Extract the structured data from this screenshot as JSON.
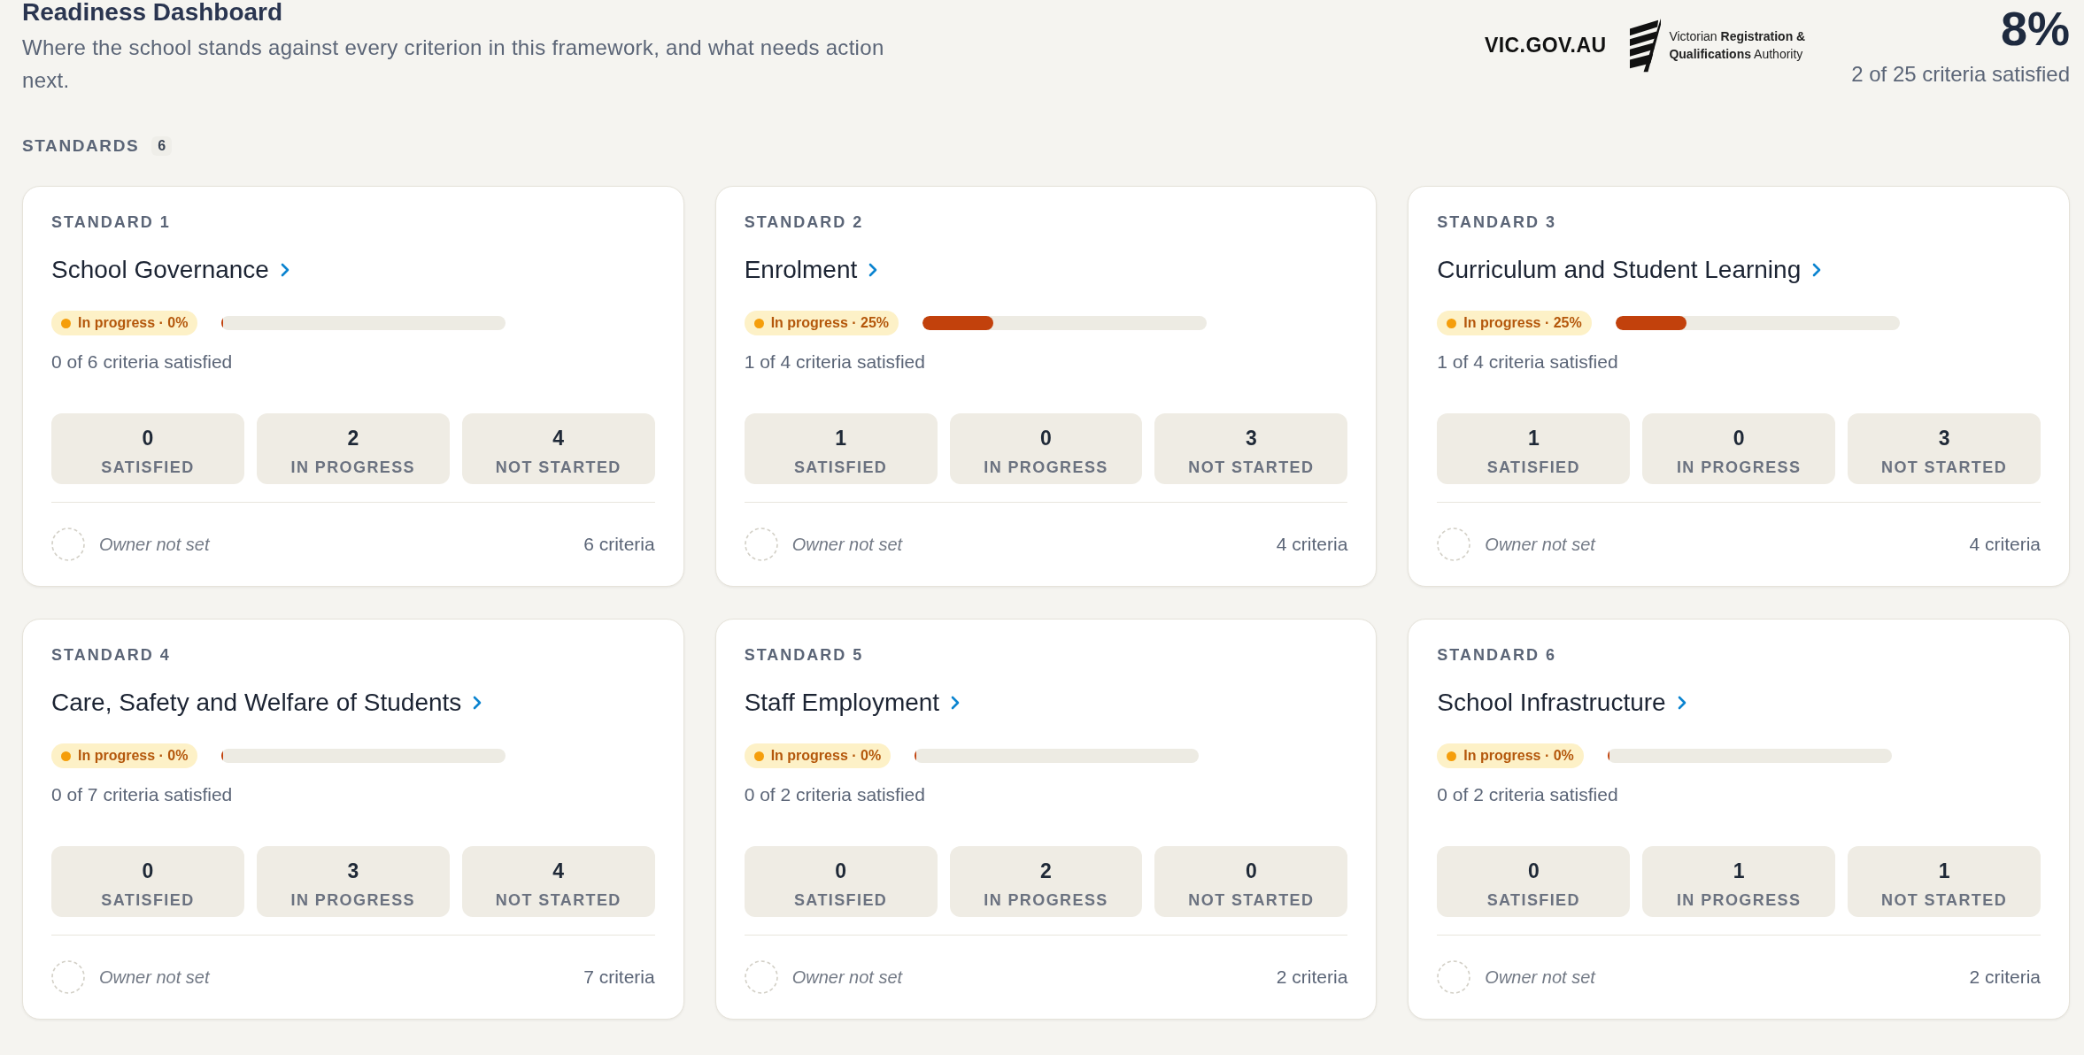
{
  "header": {
    "title": "Readiness Dashboard",
    "subtitle": "Where the school stands against every criterion in this framework, and what needs action next."
  },
  "logos": {
    "gov_wordmark": "VIC.GOV.AU",
    "authority_name": [
      "Victorian **Registration &**",
      "**Qualifications** Authority"
    ]
  },
  "summary": {
    "percent": "8%",
    "caption": "2 of 25 criteria satisfied"
  },
  "section": {
    "label": "STANDARDS",
    "count": "6"
  },
  "standards": [
    {
      "eyebrow": "STANDARD 1",
      "title": "School Governance",
      "status": {
        "kind": "in_progress",
        "label": "In progress · 0%"
      },
      "level": 0,
      "satisfied_text": "0 of 6 criteria satisfied",
      "stats": [
        {
          "value": "0",
          "label": "SATISFIED"
        },
        {
          "value": "2",
          "label": "IN PROGRESS"
        },
        {
          "value": "4",
          "label": "NOT STARTED"
        }
      ],
      "owner": "Owner not set",
      "criteria_count": "6 criteria"
    },
    {
      "eyebrow": "STANDARD 2",
      "title": "Enrolment",
      "status": {
        "kind": "in_progress",
        "label": "In progress · 25%"
      },
      "level": 0.25,
      "satisfied_text": "1 of 4 criteria satisfied",
      "stats": [
        {
          "value": "1",
          "label": "SATISFIED"
        },
        {
          "value": "0",
          "label": "IN PROGRESS"
        },
        {
          "value": "3",
          "label": "NOT STARTED"
        }
      ],
      "owner": "Owner not set",
      "criteria_count": "4 criteria"
    },
    {
      "eyebrow": "STANDARD 3",
      "title": "Curriculum and Student Learning",
      "status": {
        "kind": "in_progress",
        "label": "In progress · 25%"
      },
      "level": 0.25,
      "satisfied_text": "1 of 4 criteria satisfied",
      "stats": [
        {
          "value": "1",
          "label": "SATISFIED"
        },
        {
          "value": "0",
          "label": "IN PROGRESS"
        },
        {
          "value": "3",
          "label": "NOT STARTED"
        }
      ],
      "owner": "Owner not set",
      "criteria_count": "4 criteria"
    },
    {
      "eyebrow": "STANDARD 4",
      "title": "Care, Safety and Welfare of Students",
      "status": {
        "kind": "in_progress",
        "label": "In progress · 0%"
      },
      "level": 0,
      "satisfied_text": "0 of 7 criteria satisfied",
      "stats": [
        {
          "value": "0",
          "label": "SATISFIED"
        },
        {
          "value": "3",
          "label": "IN PROGRESS"
        },
        {
          "value": "4",
          "label": "NOT STARTED"
        }
      ],
      "owner": "Owner not set",
      "criteria_count": "7 criteria"
    },
    {
      "eyebrow": "STANDARD 5",
      "title": "Staff Employment",
      "status": {
        "kind": "in_progress",
        "label": "In progress · 0%"
      },
      "level": 0,
      "satisfied_text": "0 of 2 criteria satisfied",
      "stats": [
        {
          "value": "0",
          "label": "SATISFIED"
        },
        {
          "value": "2",
          "label": "IN PROGRESS"
        },
        {
          "value": "0",
          "label": "NOT STARTED"
        }
      ],
      "owner": "Owner not set",
      "criteria_count": "2 criteria"
    },
    {
      "eyebrow": "STANDARD 6",
      "title": "School Infrastructure",
      "status": {
        "kind": "in_progress",
        "label": "In progress · 0%"
      },
      "level": 0,
      "satisfied_text": "0 of 2 criteria satisfied",
      "stats": [
        {
          "value": "0",
          "label": "SATISFIED"
        },
        {
          "value": "1",
          "label": "IN PROGRESS"
        },
        {
          "value": "1",
          "label": "NOT STARTED"
        }
      ],
      "owner": "Owner not set",
      "criteria_count": "2 criteria"
    }
  ]
}
